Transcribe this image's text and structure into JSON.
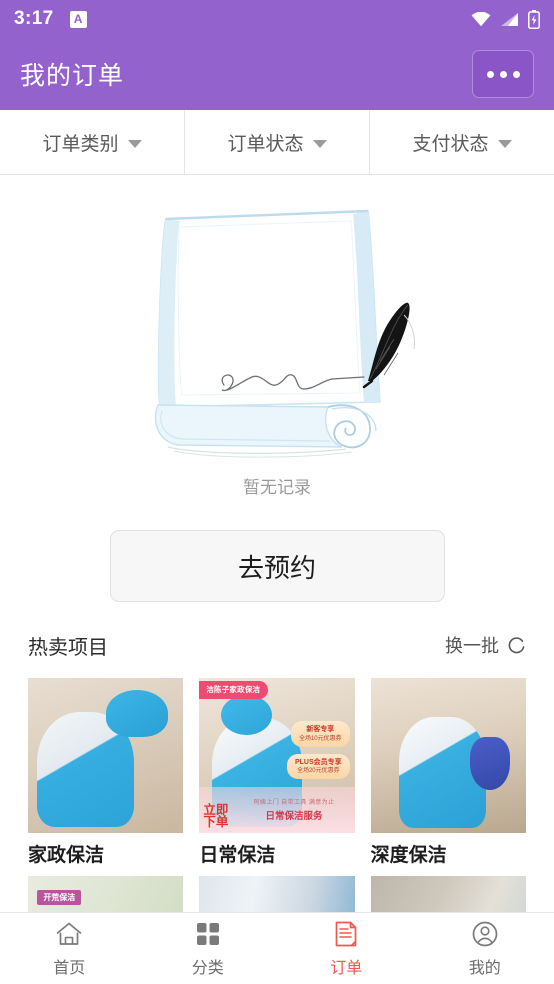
{
  "status_bar": {
    "time": "3:17",
    "app_badge": "A",
    "icons": [
      "wifi-icon",
      "cellular-signal-icon",
      "battery-charging-icon"
    ]
  },
  "app_bar": {
    "title": "我的订单",
    "menu_icon": "more-options-icon",
    "background_color": "#9362cd"
  },
  "filters": [
    {
      "label": "订单类别",
      "icon": "chevron-down-icon"
    },
    {
      "label": "订单状态",
      "icon": "chevron-down-icon"
    },
    {
      "label": "支付状态",
      "icon": "chevron-down-icon"
    }
  ],
  "empty_state": {
    "illustration": "scroll-and-quill-illustration",
    "message": "暂无记录",
    "action_label": "去预约"
  },
  "hot_section": {
    "title": "热卖项目",
    "refresh_label": "换一批",
    "refresh_icon": "refresh-icon",
    "items": [
      {
        "label": "家政保洁",
        "image": "cleaning-staff-photo-1"
      },
      {
        "label": "日常保洁",
        "image": "cleaning-staff-photo-2",
        "overlays": {
          "brand_badge": "洁陈子家政保洁",
          "promo_1_title": "新客专享",
          "promo_1_sub": "全场10元优惠券",
          "promo_2_title": "PLUS会员专享",
          "promo_2_sub": "全场20元优惠券",
          "cta": "立即下单",
          "strip_sub": "阿姨上门 自带工具 满意为止",
          "strip_main": "日常保洁服务"
        }
      },
      {
        "label": "深度保洁",
        "image": "cleaning-staff-photo-3"
      }
    ],
    "next_row_items": [
      {
        "badge": "开荒保洁",
        "image": "cleaning-supplies-photo"
      },
      {
        "image": "window-cleaning-photo"
      },
      {
        "image": "sofa-cleaning-photo"
      }
    ]
  },
  "bottom_nav": {
    "active_color": "#f0584e",
    "items": [
      {
        "label": "首页",
        "icon": "home-icon",
        "active": false
      },
      {
        "label": "分类",
        "icon": "grid-categories-icon",
        "active": false
      },
      {
        "label": "订单",
        "icon": "order-document-icon",
        "active": true
      },
      {
        "label": "我的",
        "icon": "user-profile-icon",
        "active": false
      }
    ]
  }
}
